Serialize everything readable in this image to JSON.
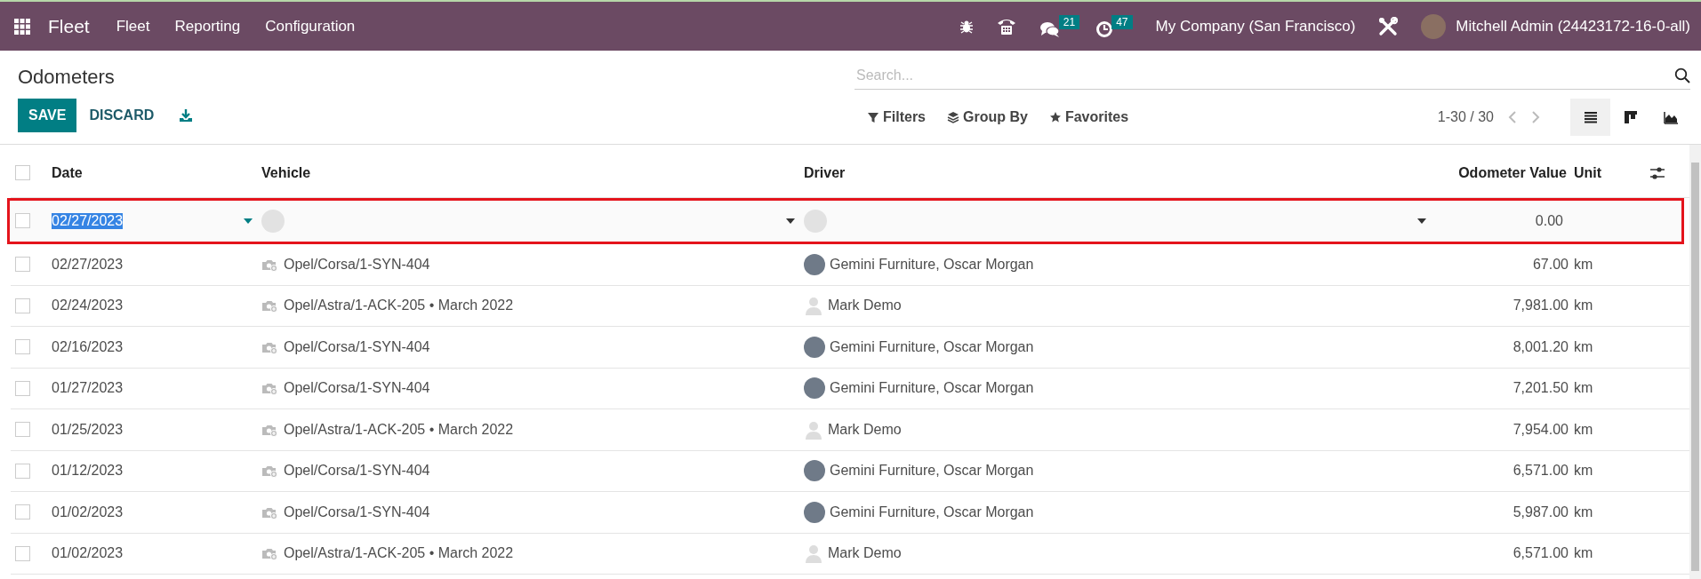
{
  "navbar": {
    "app_name": "Fleet",
    "menu": [
      {
        "label": "Fleet"
      },
      {
        "label": "Reporting"
      },
      {
        "label": "Configuration"
      }
    ],
    "messages_badge": "21",
    "activities_badge": "47",
    "company": "My Company (San Francisco)",
    "user": "Mitchell Admin (24423172-16-0-all)"
  },
  "control_panel": {
    "title": "Odometers",
    "buttons": [
      "SAVE",
      "DISCARD"
    ],
    "search": {
      "placeholder": "Search..."
    },
    "filters": [
      "Filters",
      "Group By",
      "Favorites"
    ],
    "pager": "1-30 / 30",
    "views": [
      {
        "kind": "list",
        "selected": true
      },
      {
        "kind": "kanban",
        "selected": false
      },
      {
        "kind": "graph",
        "selected": false
      }
    ]
  },
  "table": {
    "columns": [
      "Date",
      "Vehicle",
      "Driver",
      "Odometer Value",
      "Unit"
    ],
    "select_all_checked": false,
    "edit_row": {
      "checked": false,
      "date": "02/27/2023",
      "odometer": "0.00",
      "highlighted": true
    },
    "rows": [
      {
        "checked": false,
        "date": "02/27/2023",
        "vehicle": "Opel/Corsa/1-SYN-404",
        "driver": "Gemini Furniture, Oscar Morgan",
        "kind": "photo",
        "odometer": "67.00",
        "unit": "km"
      },
      {
        "checked": false,
        "date": "02/24/2023",
        "vehicle": "Opel/Astra/1-ACK-205 • March 2022",
        "driver": "Mark Demo",
        "kind": "placeholder",
        "odometer": "7,981.00",
        "unit": "km"
      },
      {
        "checked": false,
        "date": "02/16/2023",
        "vehicle": "Opel/Corsa/1-SYN-404",
        "driver": "Gemini Furniture, Oscar Morgan",
        "kind": "photo",
        "odometer": "8,001.20",
        "unit": "km"
      },
      {
        "checked": false,
        "date": "01/27/2023",
        "vehicle": "Opel/Corsa/1-SYN-404",
        "driver": "Gemini Furniture, Oscar Morgan",
        "kind": "photo",
        "odometer": "7,201.50",
        "unit": "km"
      },
      {
        "checked": false,
        "date": "01/25/2023",
        "vehicle": "Opel/Astra/1-ACK-205 • March 2022",
        "driver": "Mark Demo",
        "kind": "placeholder",
        "odometer": "7,954.00",
        "unit": "km"
      },
      {
        "checked": false,
        "date": "01/12/2023",
        "vehicle": "Opel/Corsa/1-SYN-404",
        "driver": "Gemini Furniture, Oscar Morgan",
        "kind": "photo",
        "odometer": "6,571.00",
        "unit": "km"
      },
      {
        "checked": false,
        "date": "01/02/2023",
        "vehicle": "Opel/Corsa/1-SYN-404",
        "driver": "Gemini Furniture, Oscar Morgan",
        "kind": "photo",
        "odometer": "5,987.00",
        "unit": "km"
      },
      {
        "checked": false,
        "date": "01/02/2023",
        "vehicle": "Opel/Astra/1-ACK-205 • March 2022",
        "driver": "Mark Demo",
        "kind": "placeholder",
        "odometer": "6,571.00",
        "unit": "km"
      }
    ]
  }
}
